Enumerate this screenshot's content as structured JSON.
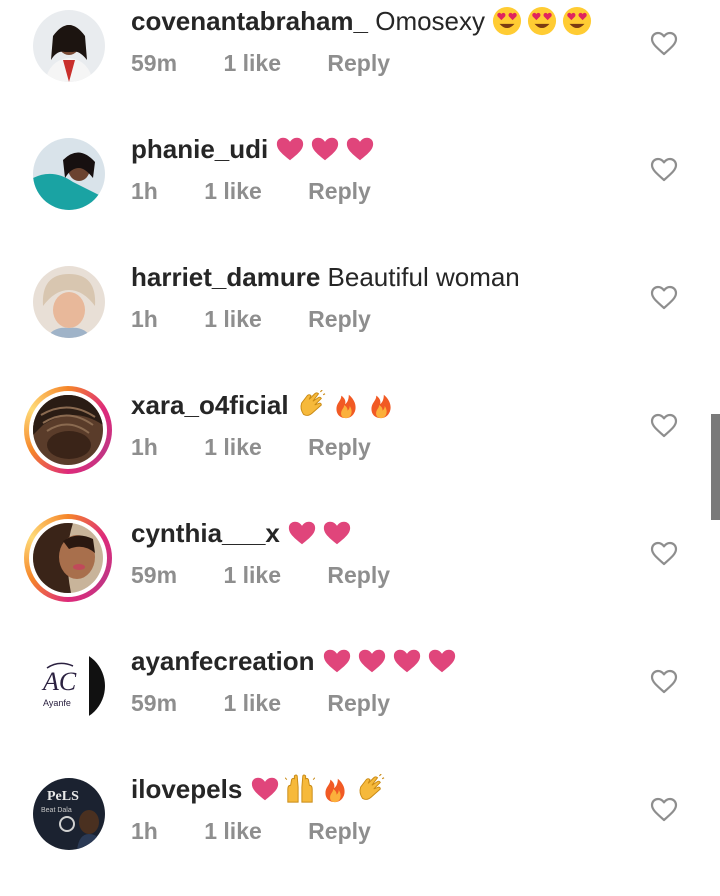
{
  "comments": [
    {
      "username": "covenantabraham_",
      "text": "Omosexy",
      "emojis": [
        "heart-eyes-emoji",
        "heart-eyes-emoji",
        "heart-eyes-emoji"
      ],
      "time": "59m",
      "likes": "1 like",
      "reply": "Reply",
      "story_ring": false
    },
    {
      "username": "phanie_udi",
      "text": "",
      "emojis": [
        "pink-heart-emoji",
        "pink-heart-emoji",
        "pink-heart-emoji"
      ],
      "time": "1h",
      "likes": "1 like",
      "reply": "Reply",
      "story_ring": false
    },
    {
      "username": "harriet_damure",
      "text": "Beautiful woman",
      "emojis": [],
      "time": "1h",
      "likes": "1 like",
      "reply": "Reply",
      "story_ring": false
    },
    {
      "username": "xara_o4ficial",
      "text": "",
      "emojis": [
        "clapping-hands-emoji",
        "fire-emoji",
        "fire-emoji"
      ],
      "time": "1h",
      "likes": "1 like",
      "reply": "Reply",
      "story_ring": true
    },
    {
      "username": "cynthia___x",
      "text": "",
      "emojis": [
        "pink-heart-emoji",
        "pink-heart-emoji"
      ],
      "time": "59m",
      "likes": "1 like",
      "reply": "Reply",
      "story_ring": true
    },
    {
      "username": "ayanfecreation",
      "text": "",
      "emojis": [
        "pink-heart-emoji",
        "pink-heart-emoji",
        "pink-heart-emoji",
        "pink-heart-emoji"
      ],
      "time": "59m",
      "likes": "1 like",
      "reply": "Reply",
      "story_ring": false
    },
    {
      "username": "ilovepels",
      "text": "",
      "emojis": [
        "pink-heart-emoji",
        "raising-hands-emoji",
        "fire-emoji",
        "clapping-hands-emoji"
      ],
      "time": "1h",
      "likes": "1 like",
      "reply": "Reply",
      "story_ring": false
    }
  ],
  "avatar_texts": {
    "ayanfecreation": "AC",
    "ayanfecreation_sub": "Ayanfe",
    "ilovepels": "PeLS",
    "ilovepels_sub": "Beat Dala"
  },
  "colors": {
    "username": "#262626",
    "meta": "#8e8e8e",
    "heart_outline": "#8e8e8e",
    "pink_heart": "#e0457b",
    "story_ring_start": "#f58529",
    "story_ring_end": "#dd2a7b"
  },
  "icons": {
    "like_button": "heart-outline-icon"
  }
}
